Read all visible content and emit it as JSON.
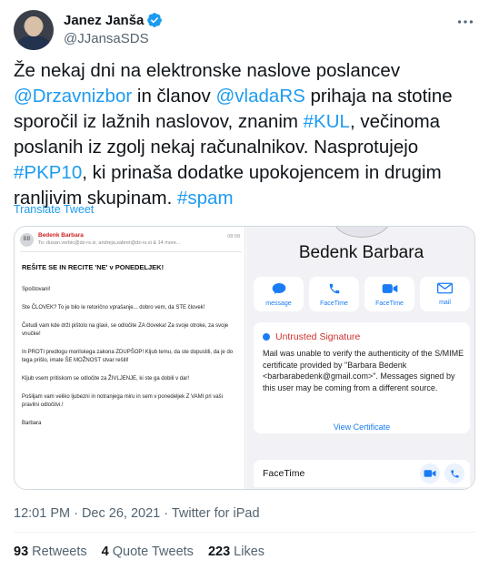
{
  "author": {
    "name": "Janez Janša",
    "handle": "@JJansaSDS"
  },
  "tweet": {
    "seg1": "Že nekaj dni na elektronske naslove poslancev ",
    "mention1": "@Drzavnizbor",
    "seg2": " in članov ",
    "mention2": "@vladaRS",
    "seg3": " prihaja na stotine sporočil iz lažnih naslovov, znanim ",
    "hashtag1": "#KUL",
    "seg4": ", večinoma poslanih iz zgolj nekaj računalnikov. Nasprotujejo ",
    "hashtag2": "#PKP10",
    "seg5": ", ki prinaša dodatke upokojencem in drugim ranljivim skupinam. ",
    "hashtag3": "#spam",
    "translate": "Translate Tweet"
  },
  "email": {
    "avatar": "BB",
    "sender": "Bedenk Barbara",
    "to": "To: dusan.verbic@dz-rs.si, andreja.zabret@dz-rs.si & 14 more...",
    "time": "08:08",
    "subject": "REŠITE SE IN RECITE 'NE' v PONEDELJEK!",
    "paragraphs": [
      "Spoštovani!",
      "Ste ČLOVEK? To je bilo le retorično vprašanje... dobro vem, da STE človek!",
      "Četudi vam kde drži pištolo na glavi, se odločite ZA človeka! Za svoje otroke, za svoje vnučke!",
      "In PROTI predlogu morilskega zakona ZDUPŠOP! Kljub temu, da ste dopustili, da je do tega prišlo, imate ŠE MOŽNOST stvar rešiti!",
      "Kljub vsem pritiskom se odločite za ŽIVLJENJE, ki ste ga dobili v dar!",
      "Pošiljam vam veliko ljubezni in notranjega miru in sem v ponedeljek Z VAMI pri vaši pravilni odločitvi.!",
      "Barbara"
    ]
  },
  "contact": {
    "name": "Bedenk Barbara",
    "actions": [
      "message",
      "FaceTime",
      "FaceTime",
      "mail"
    ],
    "untrusted_title": "Untrusted Signature",
    "untrusted_text": "Mail was unable to verify the authenticity of the S/MIME certificate provided by \"Barbara Bedenk <barbarabedenk@gmail.com>\". Messages signed by this user may be coming from a different source.",
    "view_certificate": "View Certificate",
    "facetime_label": "FaceTime"
  },
  "meta": {
    "time": "12:01 PM · Dec 26, 2021",
    "source": " · Twitter for iPad"
  },
  "stats": {
    "retweets_count": "93",
    "retweets_label": " Retweets",
    "quotes_count": "4",
    "quotes_label": " Quote Tweets",
    "likes_count": "223",
    "likes_label": " Likes"
  },
  "colors": {
    "link": "#1d9bf0",
    "untrusted": "#d0302e",
    "ios_blue": "#1a7cf5"
  }
}
